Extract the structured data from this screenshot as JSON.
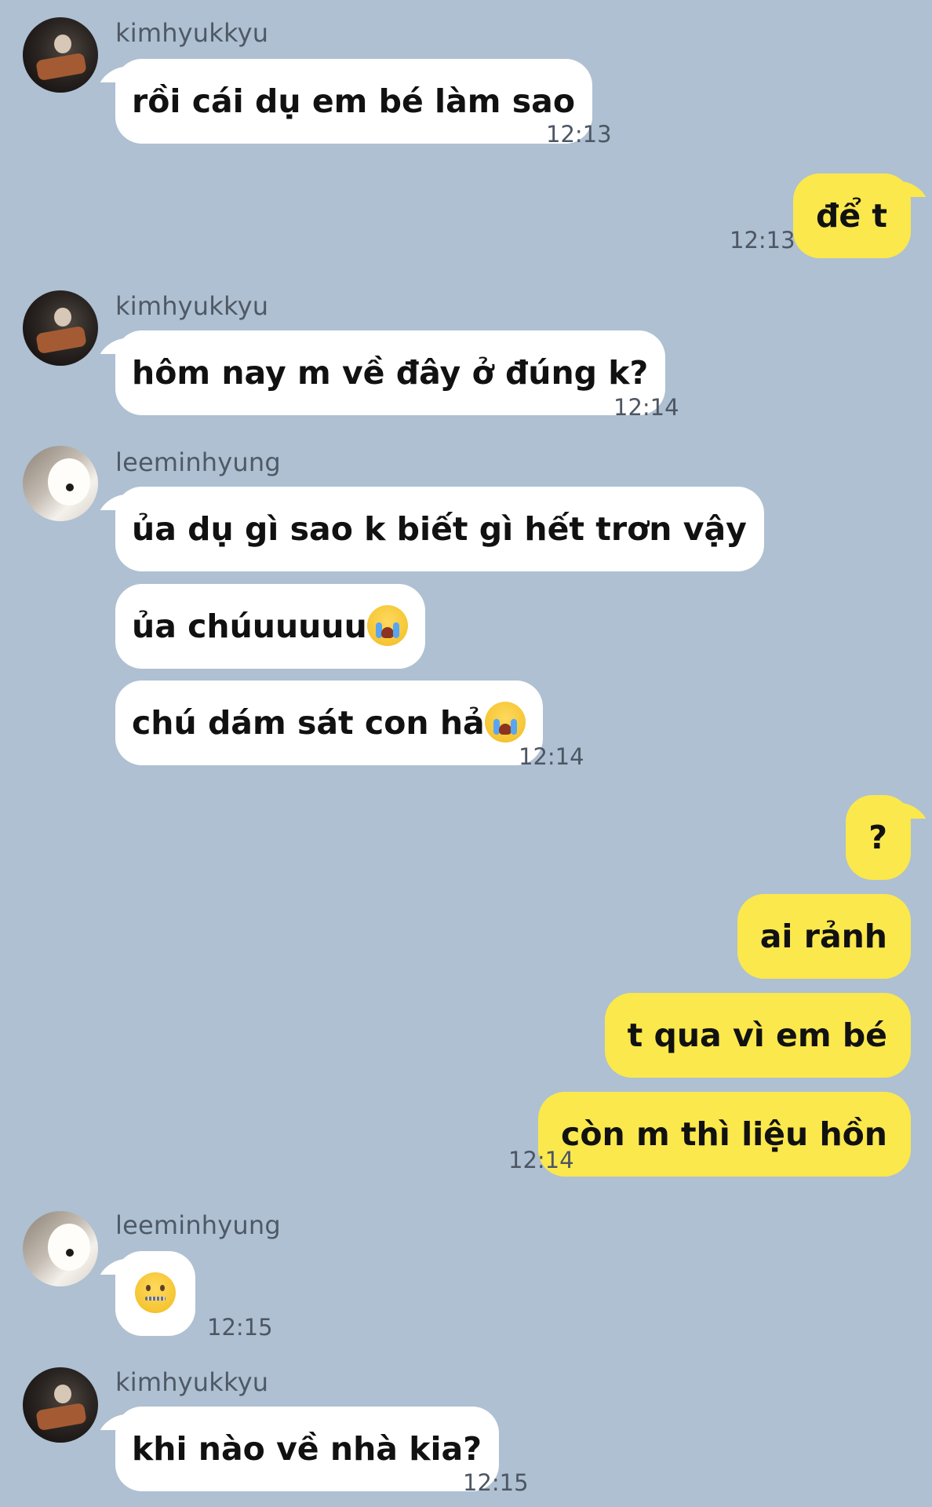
{
  "chat": {
    "messages": [
      {
        "sender": "kimhyukkyu",
        "text": "rồi cái dụ em bé làm sao",
        "time": "12:13"
      },
      {
        "text": "để t",
        "time": "12:13"
      },
      {
        "sender": "kimhyukkyu",
        "text": "hôm nay m về đây ở đúng k?",
        "time": "12:14"
      },
      {
        "sender": "leeminhyung",
        "text": "ủa dụ gì sao k biết gì hết trơn vậy"
      },
      {
        "text": "ủa chúuuuuu",
        "emoji": "loudly-crying-face"
      },
      {
        "text": "chú dám sát con hả",
        "emoji": "loudly-crying-face",
        "time": "12:14"
      },
      {
        "text": "?"
      },
      {
        "text": "ai rảnh"
      },
      {
        "text": "t qua vì em bé"
      },
      {
        "text": "còn m thì liệu hồn",
        "time": "12:14"
      },
      {
        "sender": "leeminhyung",
        "emoji": "zipper-mouth-face",
        "time": "12:15"
      },
      {
        "sender": "kimhyukkyu",
        "text": "khi nào về nhà kia?",
        "time": "12:15"
      }
    ]
  }
}
